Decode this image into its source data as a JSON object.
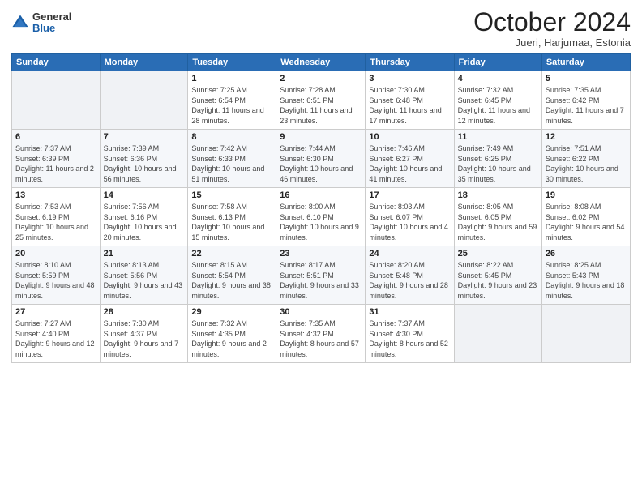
{
  "header": {
    "logo": {
      "general": "General",
      "blue": "Blue"
    },
    "title": "October 2024",
    "location": "Jueri, Harjumaa, Estonia"
  },
  "weekdays": [
    "Sunday",
    "Monday",
    "Tuesday",
    "Wednesday",
    "Thursday",
    "Friday",
    "Saturday"
  ],
  "weeks": [
    [
      {
        "day": "",
        "sunrise": "",
        "sunset": "",
        "daylight": ""
      },
      {
        "day": "",
        "sunrise": "",
        "sunset": "",
        "daylight": ""
      },
      {
        "day": "1",
        "sunrise": "Sunrise: 7:25 AM",
        "sunset": "Sunset: 6:54 PM",
        "daylight": "Daylight: 11 hours and 28 minutes."
      },
      {
        "day": "2",
        "sunrise": "Sunrise: 7:28 AM",
        "sunset": "Sunset: 6:51 PM",
        "daylight": "Daylight: 11 hours and 23 minutes."
      },
      {
        "day": "3",
        "sunrise": "Sunrise: 7:30 AM",
        "sunset": "Sunset: 6:48 PM",
        "daylight": "Daylight: 11 hours and 17 minutes."
      },
      {
        "day": "4",
        "sunrise": "Sunrise: 7:32 AM",
        "sunset": "Sunset: 6:45 PM",
        "daylight": "Daylight: 11 hours and 12 minutes."
      },
      {
        "day": "5",
        "sunrise": "Sunrise: 7:35 AM",
        "sunset": "Sunset: 6:42 PM",
        "daylight": "Daylight: 11 hours and 7 minutes."
      }
    ],
    [
      {
        "day": "6",
        "sunrise": "Sunrise: 7:37 AM",
        "sunset": "Sunset: 6:39 PM",
        "daylight": "Daylight: 11 hours and 2 minutes."
      },
      {
        "day": "7",
        "sunrise": "Sunrise: 7:39 AM",
        "sunset": "Sunset: 6:36 PM",
        "daylight": "Daylight: 10 hours and 56 minutes."
      },
      {
        "day": "8",
        "sunrise": "Sunrise: 7:42 AM",
        "sunset": "Sunset: 6:33 PM",
        "daylight": "Daylight: 10 hours and 51 minutes."
      },
      {
        "day": "9",
        "sunrise": "Sunrise: 7:44 AM",
        "sunset": "Sunset: 6:30 PM",
        "daylight": "Daylight: 10 hours and 46 minutes."
      },
      {
        "day": "10",
        "sunrise": "Sunrise: 7:46 AM",
        "sunset": "Sunset: 6:27 PM",
        "daylight": "Daylight: 10 hours and 41 minutes."
      },
      {
        "day": "11",
        "sunrise": "Sunrise: 7:49 AM",
        "sunset": "Sunset: 6:25 PM",
        "daylight": "Daylight: 10 hours and 35 minutes."
      },
      {
        "day": "12",
        "sunrise": "Sunrise: 7:51 AM",
        "sunset": "Sunset: 6:22 PM",
        "daylight": "Daylight: 10 hours and 30 minutes."
      }
    ],
    [
      {
        "day": "13",
        "sunrise": "Sunrise: 7:53 AM",
        "sunset": "Sunset: 6:19 PM",
        "daylight": "Daylight: 10 hours and 25 minutes."
      },
      {
        "day": "14",
        "sunrise": "Sunrise: 7:56 AM",
        "sunset": "Sunset: 6:16 PM",
        "daylight": "Daylight: 10 hours and 20 minutes."
      },
      {
        "day": "15",
        "sunrise": "Sunrise: 7:58 AM",
        "sunset": "Sunset: 6:13 PM",
        "daylight": "Daylight: 10 hours and 15 minutes."
      },
      {
        "day": "16",
        "sunrise": "Sunrise: 8:00 AM",
        "sunset": "Sunset: 6:10 PM",
        "daylight": "Daylight: 10 hours and 9 minutes."
      },
      {
        "day": "17",
        "sunrise": "Sunrise: 8:03 AM",
        "sunset": "Sunset: 6:07 PM",
        "daylight": "Daylight: 10 hours and 4 minutes."
      },
      {
        "day": "18",
        "sunrise": "Sunrise: 8:05 AM",
        "sunset": "Sunset: 6:05 PM",
        "daylight": "Daylight: 9 hours and 59 minutes."
      },
      {
        "day": "19",
        "sunrise": "Sunrise: 8:08 AM",
        "sunset": "Sunset: 6:02 PM",
        "daylight": "Daylight: 9 hours and 54 minutes."
      }
    ],
    [
      {
        "day": "20",
        "sunrise": "Sunrise: 8:10 AM",
        "sunset": "Sunset: 5:59 PM",
        "daylight": "Daylight: 9 hours and 48 minutes."
      },
      {
        "day": "21",
        "sunrise": "Sunrise: 8:13 AM",
        "sunset": "Sunset: 5:56 PM",
        "daylight": "Daylight: 9 hours and 43 minutes."
      },
      {
        "day": "22",
        "sunrise": "Sunrise: 8:15 AM",
        "sunset": "Sunset: 5:54 PM",
        "daylight": "Daylight: 9 hours and 38 minutes."
      },
      {
        "day": "23",
        "sunrise": "Sunrise: 8:17 AM",
        "sunset": "Sunset: 5:51 PM",
        "daylight": "Daylight: 9 hours and 33 minutes."
      },
      {
        "day": "24",
        "sunrise": "Sunrise: 8:20 AM",
        "sunset": "Sunset: 5:48 PM",
        "daylight": "Daylight: 9 hours and 28 minutes."
      },
      {
        "day": "25",
        "sunrise": "Sunrise: 8:22 AM",
        "sunset": "Sunset: 5:45 PM",
        "daylight": "Daylight: 9 hours and 23 minutes."
      },
      {
        "day": "26",
        "sunrise": "Sunrise: 8:25 AM",
        "sunset": "Sunset: 5:43 PM",
        "daylight": "Daylight: 9 hours and 18 minutes."
      }
    ],
    [
      {
        "day": "27",
        "sunrise": "Sunrise: 7:27 AM",
        "sunset": "Sunset: 4:40 PM",
        "daylight": "Daylight: 9 hours and 12 minutes."
      },
      {
        "day": "28",
        "sunrise": "Sunrise: 7:30 AM",
        "sunset": "Sunset: 4:37 PM",
        "daylight": "Daylight: 9 hours and 7 minutes."
      },
      {
        "day": "29",
        "sunrise": "Sunrise: 7:32 AM",
        "sunset": "Sunset: 4:35 PM",
        "daylight": "Daylight: 9 hours and 2 minutes."
      },
      {
        "day": "30",
        "sunrise": "Sunrise: 7:35 AM",
        "sunset": "Sunset: 4:32 PM",
        "daylight": "Daylight: 8 hours and 57 minutes."
      },
      {
        "day": "31",
        "sunrise": "Sunrise: 7:37 AM",
        "sunset": "Sunset: 4:30 PM",
        "daylight": "Daylight: 8 hours and 52 minutes."
      },
      {
        "day": "",
        "sunrise": "",
        "sunset": "",
        "daylight": ""
      },
      {
        "day": "",
        "sunrise": "",
        "sunset": "",
        "daylight": ""
      }
    ]
  ]
}
